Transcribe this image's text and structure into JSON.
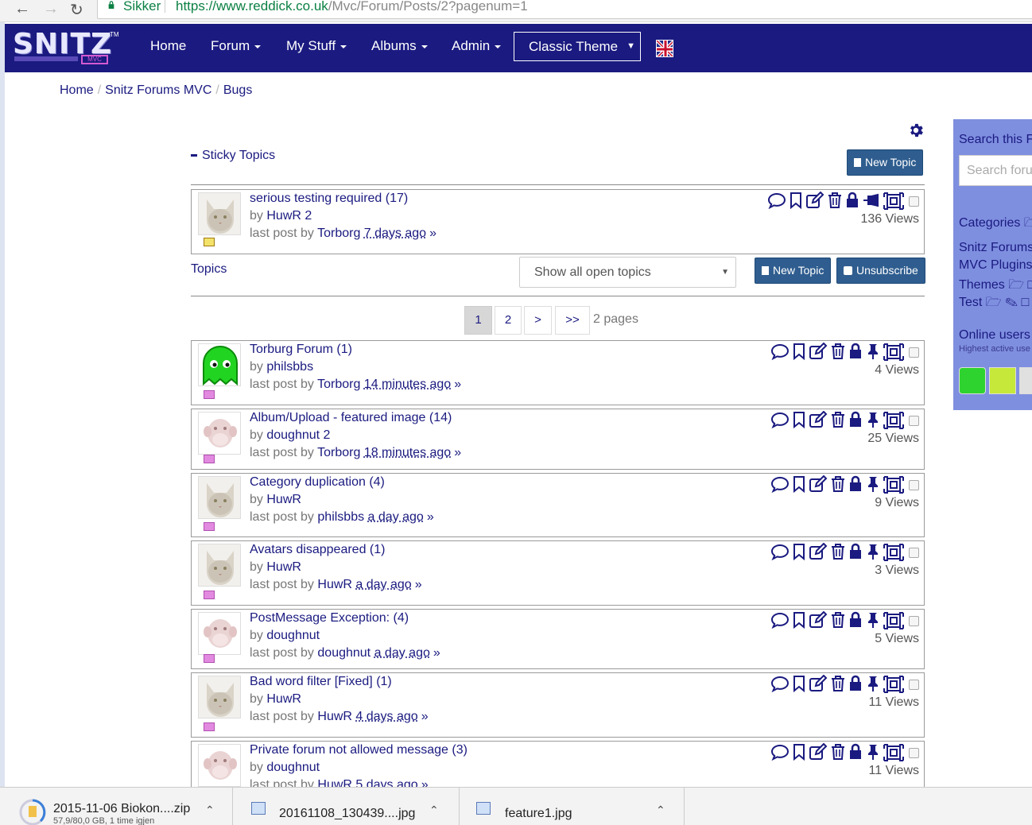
{
  "browser": {
    "secure_label": "Sikker",
    "url_host": "https://www.reddick.co.uk",
    "url_path": "/Mvc/Forum/Posts/2?pagenum=1"
  },
  "navbar": {
    "items": [
      "Home",
      "Forum",
      "My Stuff",
      "Albums",
      "Admin"
    ],
    "theme_select": "Classic Theme"
  },
  "breadcrumb": [
    "Home",
    "Snitz Forums MVC",
    "Bugs"
  ],
  "sticky_heading": "Sticky Topics",
  "buttons": {
    "new_topic": "New Topic",
    "unsubscribe": "Unsubscribe"
  },
  "sticky_topics": [
    {
      "title": "serious testing required",
      "count": "(17)",
      "author": "HuwR 2",
      "last_by": "Torborg",
      "ago": "7 days ago",
      "views": "136 Views",
      "avatar": "cat"
    }
  ],
  "topics_label": "Topics",
  "filter": {
    "selected": "Show all open topics"
  },
  "pagination": {
    "pages": [
      "1",
      "2",
      ">",
      ">>"
    ],
    "label": "2 pages"
  },
  "topics": [
    {
      "title": "Torburg Forum",
      "count": "(1)",
      "author": "philsbbs",
      "last_by": "Torborg",
      "ago": "14 minutes ago",
      "views": "4 Views",
      "avatar": "ghost"
    },
    {
      "title": "Album/Upload - featured image",
      "count": "(14)",
      "author": "doughnut 2",
      "last_by": "Torborg",
      "ago": "18 minutes ago",
      "views": "25 Views",
      "avatar": "monkey"
    },
    {
      "title": "Category duplication",
      "count": "(4)",
      "author": "HuwR",
      "last_by": "philsbbs",
      "ago": "a day ago",
      "views": "9 Views",
      "avatar": "cat"
    },
    {
      "title": "Avatars disappeared",
      "count": "(1)",
      "author": "HuwR",
      "last_by": "HuwR",
      "ago": "a day ago",
      "views": "3 Views",
      "avatar": "cat"
    },
    {
      "title": "PostMessage Exception:",
      "count": "(4)",
      "author": "doughnut",
      "last_by": "doughnut",
      "ago": "a day ago",
      "views": "5 Views",
      "avatar": "monkey"
    },
    {
      "title": "Bad word filter [Fixed]",
      "count": "(1)",
      "author": "HuwR",
      "last_by": "HuwR",
      "ago": "4 days ago",
      "views": "11 Views",
      "avatar": "cat"
    },
    {
      "title": "Private forum not allowed message",
      "count": "(3)",
      "author": "doughnut",
      "last_by": "HuwR",
      "ago": "5 days ago",
      "views": "11 Views",
      "avatar": "monkey"
    }
  ],
  "strings": {
    "by": "by",
    "last_post_by": "last post by",
    "raquo": "»"
  },
  "sidebar": {
    "search_title": "Search this F",
    "search_placeholder": "Search foru",
    "categories_title": "Categories",
    "links": [
      "Snitz Forums",
      "MVC Plugins",
      "Themes",
      "Test"
    ],
    "online_title": "Online users",
    "online_sub": "Highest active use"
  },
  "downloads": [
    {
      "name": "2015-11-06 Biokon....zip",
      "sub": "57,9/80,0 GB, 1 time igjen"
    },
    {
      "name": "20161108_130439....jpg",
      "sub": ""
    },
    {
      "name": "feature1.jpg",
      "sub": ""
    }
  ],
  "colors": {
    "navbar": "#1a1a80",
    "button": "#2f5d8f",
    "sidebar": "#7f8fe0"
  }
}
